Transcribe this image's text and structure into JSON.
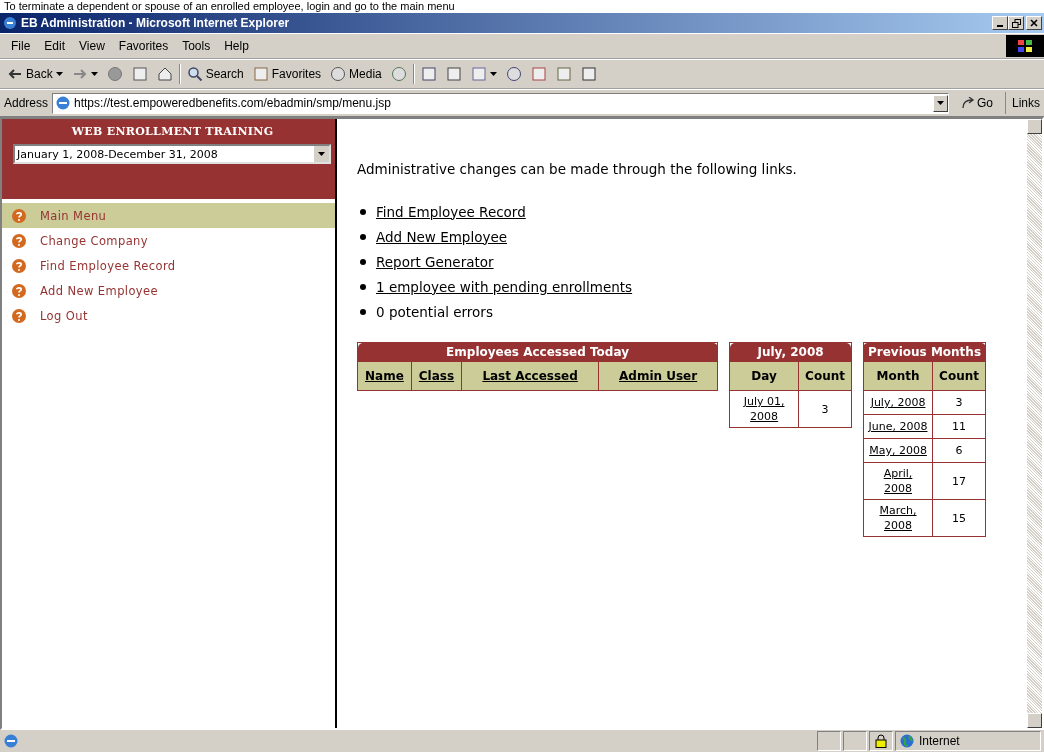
{
  "caption": "To terminate a dependent or spouse of an enrolled employee, login and go to the main menu",
  "window": {
    "title": "EB Administration - Microsoft Internet Explorer"
  },
  "menu_bar": [
    "File",
    "Edit",
    "View",
    "Favorites",
    "Tools",
    "Help"
  ],
  "toolbar": [
    {
      "kind": "back",
      "label": "Back"
    },
    {
      "kind": "forward"
    },
    {
      "kind": "stop"
    },
    {
      "kind": "refresh"
    },
    {
      "kind": "home"
    },
    {
      "kind": "search",
      "label": "Search"
    },
    {
      "kind": "favorites",
      "label": "Favorites"
    },
    {
      "kind": "media",
      "label": "Media"
    },
    {
      "kind": "history"
    },
    {
      "kind": "mail"
    },
    {
      "kind": "print"
    },
    {
      "kind": "edit"
    },
    {
      "kind": "discuss"
    },
    {
      "kind": "messenger"
    },
    {
      "kind": "tools"
    },
    {
      "kind": "extra"
    }
  ],
  "address": {
    "label": "Address",
    "url": "https://test.empoweredbenefits.com/ebadmin/smp/menu.jsp",
    "go": "Go",
    "links": "Links"
  },
  "sidebar": {
    "title": "WEB ENROLLMENT TRAINING",
    "period": "January 1, 2008-December 31, 2008",
    "items": [
      {
        "label": "Main Menu",
        "selected": true
      },
      {
        "label": "Change Company",
        "selected": false
      },
      {
        "label": "Find Employee Record",
        "selected": false
      },
      {
        "label": "Add New Employee",
        "selected": false
      },
      {
        "label": "Log Out",
        "selected": false
      }
    ]
  },
  "content": {
    "intro": "Administrative changes can be made through the following links.",
    "bullets": [
      {
        "kind": "link",
        "text": "Find Employee Record"
      },
      {
        "kind": "link",
        "text": "Add New Employee"
      },
      {
        "kind": "link",
        "text": "Report Generator"
      },
      {
        "kind": "link",
        "text": "1 employee with pending enrollments"
      },
      {
        "kind": "plain",
        "text": "0 potential errors"
      }
    ]
  },
  "tables": [
    {
      "title": "Employees Accessed Today",
      "columns": [
        "Name",
        "Class",
        "Last Accessed",
        "Admin User"
      ],
      "linked_headers": true
    },
    {
      "title": "July, 2008",
      "columns": [
        "Day",
        "Count"
      ],
      "linked_headers": false,
      "rows": [
        [
          "July 01, 2008",
          "3"
        ]
      ]
    },
    {
      "title": "Previous Months",
      "columns": [
        "Month",
        "Count"
      ],
      "linked_headers": false,
      "rows": [
        [
          "July, 2008",
          "3"
        ],
        [
          "June, 2008",
          "11"
        ],
        [
          "May, 2008",
          "6"
        ],
        [
          "April, 2008",
          "17"
        ],
        [
          "March, 2008",
          "15"
        ]
      ]
    }
  ],
  "status_bar": {
    "zone": "Internet"
  }
}
